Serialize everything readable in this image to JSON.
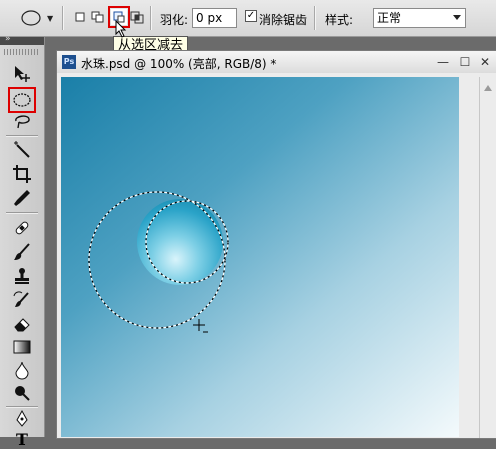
{
  "options_bar": {
    "feather_label": "羽化:",
    "feather_value": "0 px",
    "antialias_label": "消除锯齿",
    "style_label": "样式:",
    "style_value": "正常",
    "active_mode_tooltip": "从选区减去"
  },
  "document": {
    "icon_text": "Ps",
    "title": "水珠.psd @ 100% (亮部, RGB/8) *",
    "minimize": "—",
    "restore": "☐",
    "close": "✕"
  },
  "toolbox": {
    "collapse_glyph": "»",
    "text_tool_glyph": "T"
  },
  "colors": {
    "highlight": "#dd0000",
    "canvas_dark": "#1a7fa8",
    "canvas_light": "#f4fafc"
  }
}
